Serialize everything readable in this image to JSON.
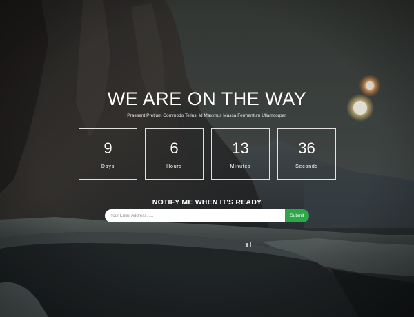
{
  "hero": {
    "title": "WE ARE ON THE WAY",
    "subtitle": "Praesent Pretium Commodo Tellus, Id Maximus Massa Fermentum Ullamcorper."
  },
  "countdown": [
    {
      "value": "9",
      "label": "Days"
    },
    {
      "value": "6",
      "label": "Hours"
    },
    {
      "value": "13",
      "label": "Minutes"
    },
    {
      "value": "36",
      "label": "Seconds"
    }
  ],
  "notify": {
    "heading": "NOTIFY ME WHEN IT'S READY",
    "email_placeholder": "Your Email Address......",
    "email_value": "",
    "submit_label": "Submit"
  },
  "colors": {
    "accent": "#2ca84a",
    "text": "#ffffff"
  }
}
